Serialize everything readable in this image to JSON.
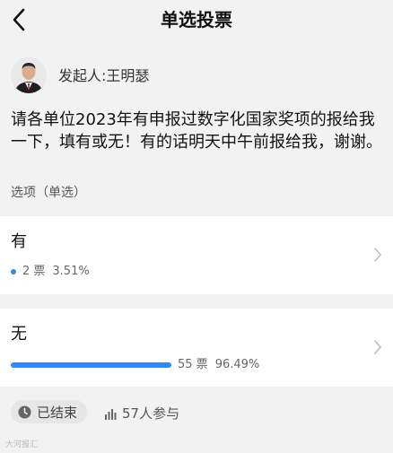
{
  "header": {
    "title": "单选投票"
  },
  "poll": {
    "initiator": "发起人:王明瑟",
    "question": "请各单位2023年有申报过数字化国家奖项的报给我一下，填有或无！有的话明天中午前报给我，谢谢。",
    "option_type": "选项（单选）",
    "options": [
      {
        "label": "有",
        "votes": "2 票",
        "percent": "3.51%",
        "fraction": 0.0351
      },
      {
        "label": "无",
        "votes": "55 票",
        "percent": "96.49%",
        "fraction": 0.9649
      }
    ]
  },
  "footer": {
    "status": "已结束",
    "participants": "57人参与"
  },
  "watermark": "大河报汇",
  "colors": {
    "accent": "#2f8af5",
    "background": "#f2f2f2",
    "card": "#ffffff"
  },
  "icons": {
    "back": "chevron-left-icon",
    "option_arrow": "chevron-right-icon",
    "status": "clock-icon",
    "participants": "bar-chart-icon"
  }
}
